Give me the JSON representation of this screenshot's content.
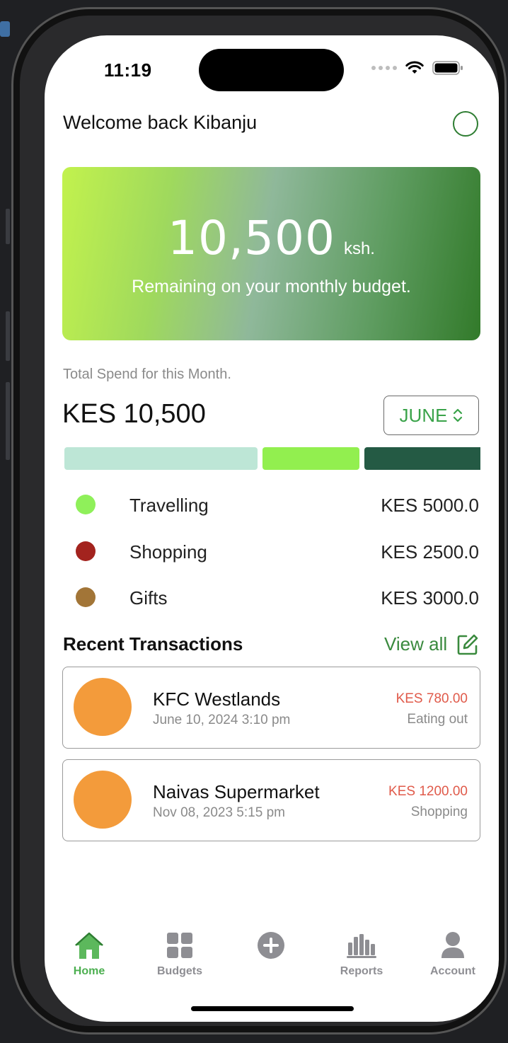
{
  "status": {
    "time": "11:19"
  },
  "header": {
    "welcome": "Welcome back Kibanju"
  },
  "hero": {
    "amount": "10,500",
    "unit": "ksh.",
    "subtitle": "Remaining on your monthly budget."
  },
  "spend": {
    "label": "Total Spend for this Month.",
    "total": "KES 10,500",
    "month": "JUNE"
  },
  "spend_bar": [
    {
      "color": "#bde6d6",
      "fraction": 0.476
    },
    {
      "color": "#92ef4f",
      "fraction": 0.238
    },
    {
      "color": "#245a44",
      "fraction": 0.286
    }
  ],
  "categories": [
    {
      "name": "Travelling",
      "amount": "KES 5000.0",
      "color": "#8ff05a"
    },
    {
      "name": "Shopping",
      "amount": "KES 2500.0",
      "color": "#a3231e"
    },
    {
      "name": "Gifts",
      "amount": "KES 3000.0",
      "color": "#a27537"
    }
  ],
  "recent": {
    "title": "Recent Transactions",
    "view_all": "View all",
    "items": [
      {
        "name": "KFC Westlands",
        "date": "June 10, 2024 3:10 pm",
        "amount": "KES 780.00",
        "category": "Eating out"
      },
      {
        "name": "Naivas Supermarket",
        "date": "Nov 08, 2023 5:15 pm",
        "amount": "KES 1200.00",
        "category": "Shopping"
      }
    ]
  },
  "tabs": [
    {
      "label": "Home",
      "icon": "home-icon",
      "active": true
    },
    {
      "label": "Budgets",
      "icon": "grid-icon",
      "active": false
    },
    {
      "label": "",
      "icon": "plus-circle-icon",
      "active": false
    },
    {
      "label": "Reports",
      "icon": "bar-chart-icon",
      "active": false
    },
    {
      "label": "Account",
      "icon": "user-icon",
      "active": false
    }
  ],
  "colors": {
    "accent": "#3aa34a",
    "expense": "#e05a4a",
    "avatar": "#f39b3b"
  }
}
